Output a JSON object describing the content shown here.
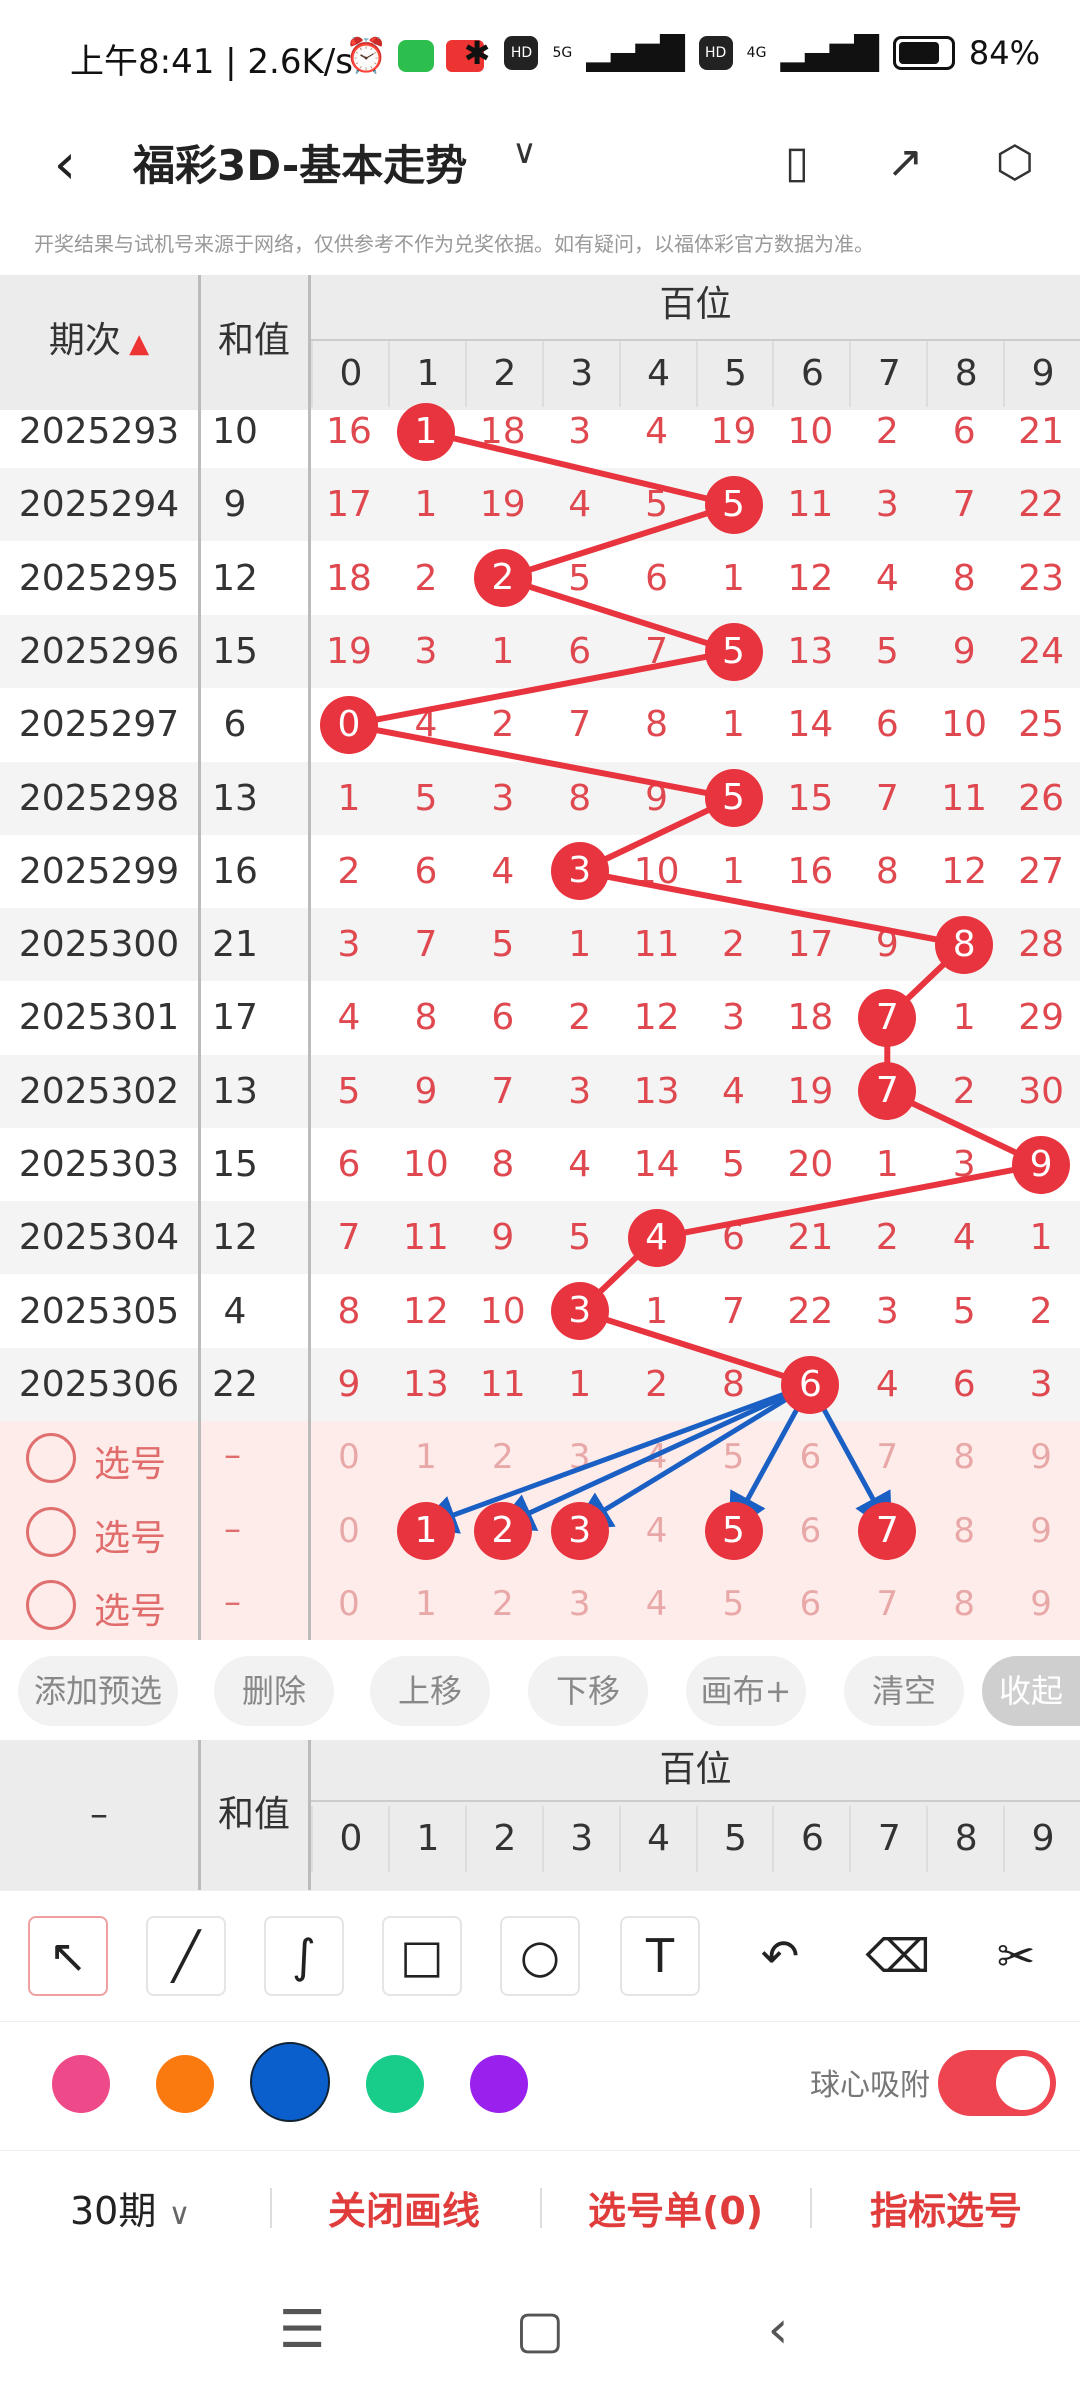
{
  "status": {
    "time": "上午8:41 | 2.6K/s",
    "battery": "84%",
    "hd1": "HD",
    "hd2": "HD",
    "n5g": "5G",
    "n4g": "4G"
  },
  "header": {
    "title": "福彩3D-基本走势",
    "back_label": "<",
    "caret": "∨"
  },
  "disclaimer": "开奖结果与试机号来源于网络，仅供参考不作为兑奖依据。如有疑问，以福体彩官方数据为准。",
  "table": {
    "col_issue": "期次",
    "col_sum": "和值",
    "group": "百位",
    "digits": [
      "0",
      "1",
      "2",
      "3",
      "4",
      "5",
      "6",
      "7",
      "8",
      "9"
    ],
    "rows": [
      {
        "issue": "2025293",
        "sum": "10",
        "cells": [
          "16",
          "1",
          "18",
          "3",
          "4",
          "19",
          "10",
          "2",
          "6",
          "21"
        ],
        "hit": 1
      },
      {
        "issue": "2025294",
        "sum": "9",
        "cells": [
          "17",
          "1",
          "19",
          "4",
          "5",
          "5",
          "11",
          "3",
          "7",
          "22"
        ],
        "hit": 5
      },
      {
        "issue": "2025295",
        "sum": "12",
        "cells": [
          "18",
          "2",
          "2",
          "5",
          "6",
          "1",
          "12",
          "4",
          "8",
          "23"
        ],
        "hit": 2
      },
      {
        "issue": "2025296",
        "sum": "15",
        "cells": [
          "19",
          "3",
          "1",
          "6",
          "7",
          "5",
          "13",
          "5",
          "9",
          "24"
        ],
        "hit": 5
      },
      {
        "issue": "2025297",
        "sum": "6",
        "cells": [
          "0",
          "4",
          "2",
          "7",
          "8",
          "1",
          "14",
          "6",
          "10",
          "25"
        ],
        "hit": 0
      },
      {
        "issue": "2025298",
        "sum": "13",
        "cells": [
          "1",
          "5",
          "3",
          "8",
          "9",
          "5",
          "15",
          "7",
          "11",
          "26"
        ],
        "hit": 5
      },
      {
        "issue": "2025299",
        "sum": "16",
        "cells": [
          "2",
          "6",
          "4",
          "3",
          "10",
          "1",
          "16",
          "8",
          "12",
          "27"
        ],
        "hit": 3
      },
      {
        "issue": "2025300",
        "sum": "21",
        "cells": [
          "3",
          "7",
          "5",
          "1",
          "11",
          "2",
          "17",
          "9",
          "8",
          "28"
        ],
        "hit": 8
      },
      {
        "issue": "2025301",
        "sum": "17",
        "cells": [
          "4",
          "8",
          "6",
          "2",
          "12",
          "3",
          "18",
          "7",
          "1",
          "29"
        ],
        "hit": 7
      },
      {
        "issue": "2025302",
        "sum": "13",
        "cells": [
          "5",
          "9",
          "7",
          "3",
          "13",
          "4",
          "19",
          "7",
          "2",
          "30"
        ],
        "hit": 7
      },
      {
        "issue": "2025303",
        "sum": "15",
        "cells": [
          "6",
          "10",
          "8",
          "4",
          "14",
          "5",
          "20",
          "1",
          "3",
          "9"
        ],
        "hit": 9
      },
      {
        "issue": "2025304",
        "sum": "12",
        "cells": [
          "7",
          "11",
          "9",
          "5",
          "4",
          "6",
          "21",
          "2",
          "4",
          "1"
        ],
        "hit": 4
      },
      {
        "issue": "2025305",
        "sum": "4",
        "cells": [
          "8",
          "12",
          "10",
          "3",
          "1",
          "7",
          "22",
          "3",
          "5",
          "2"
        ],
        "hit": 3
      },
      {
        "issue": "2025306",
        "sum": "22",
        "cells": [
          "9",
          "13",
          "11",
          "1",
          "2",
          "8",
          "6",
          "4",
          "6",
          "3"
        ],
        "hit": 6
      }
    ],
    "picks": [
      {
        "label": "选号",
        "sum": "–",
        "cells": [
          "0",
          "1",
          "2",
          "3",
          "4",
          "5",
          "6",
          "7",
          "8",
          "9"
        ],
        "selected": []
      },
      {
        "label": "选号",
        "sum": "–",
        "cells": [
          "0",
          "1",
          "2",
          "3",
          "4",
          "5",
          "6",
          "7",
          "8",
          "9"
        ],
        "selected": [
          1,
          2,
          3,
          5,
          7
        ]
      },
      {
        "label": "选号",
        "sum": "–",
        "cells": [
          "0",
          "1",
          "2",
          "3",
          "4",
          "5",
          "6",
          "7",
          "8",
          "9"
        ],
        "selected": []
      }
    ]
  },
  "actions": [
    "添加预选",
    "删除",
    "上移",
    "下移",
    "画布+",
    "清空",
    "收起"
  ],
  "table2": {
    "col_issue": "–",
    "col_sum": "和值",
    "group": "百位"
  },
  "tools": [
    "arrow-tool",
    "line-tool",
    "curve-tool",
    "rect-tool",
    "circle-tool",
    "text-tool",
    "undo-tool",
    "eraser-tool",
    "clear-tool"
  ],
  "colors": [
    "#ee4a8a",
    "#fb7a10",
    "#0a5fcc",
    "#18cc8a",
    "#9a20ee"
  ],
  "snap_label": "球心吸附",
  "bottom": {
    "period": "30期",
    "close_lines": "关闭画线",
    "pick_list": "选号单(0)",
    "indicator_pick": "指标选号"
  },
  "colors_theme": {
    "red": "#e8343e",
    "blue": "#1a5fc4"
  }
}
